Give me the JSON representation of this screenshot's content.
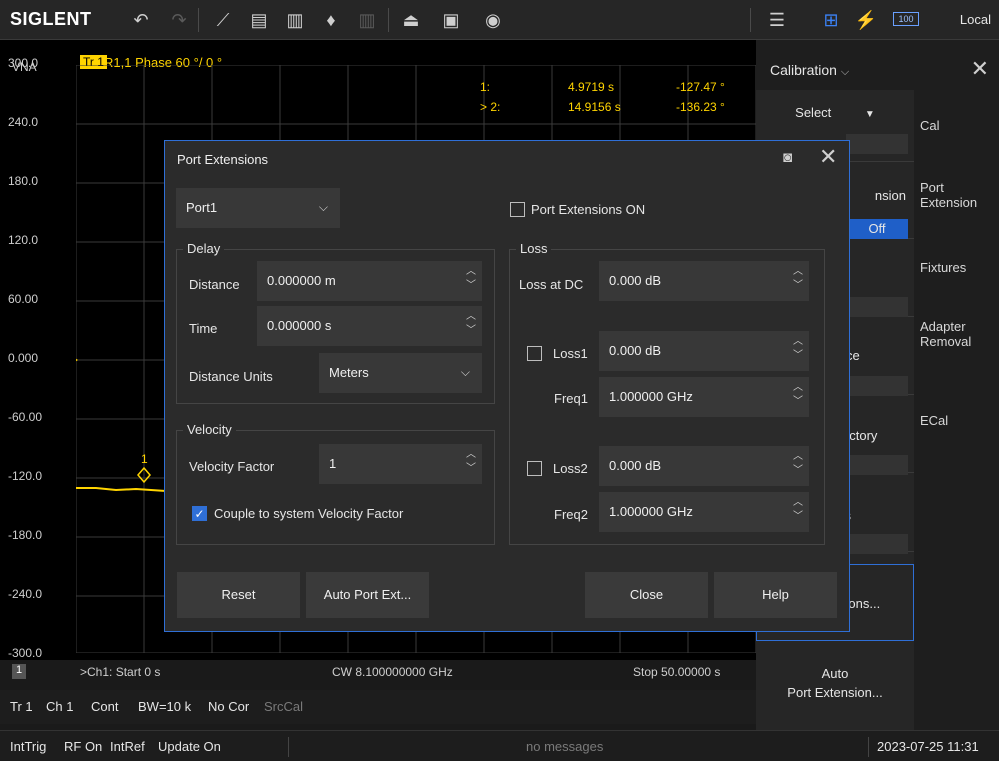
{
  "toolbar": {
    "logo": "SIGLENT",
    "icons": [
      "undo-icon",
      "redo-icon",
      "add-marker-icon",
      "add-trace-icon",
      "add-channel-icon",
      "add-marker-search-icon",
      "delete-icon",
      "open-file-icon",
      "save-icon",
      "screenshot-icon",
      "menu-icon",
      "usb-icon",
      "power-icon",
      "battery-icon"
    ],
    "battery": "100",
    "local": "Local"
  },
  "plot": {
    "vna": "VNA",
    "trace_badge": "Tr 1",
    "trace_info": "R1,1 Phase 60 °/ 0 °",
    "y_ticks": [
      "300.0",
      "240.0",
      "180.0",
      "120.0",
      "60.00",
      "0.000",
      "-60.00",
      "-120.0",
      "-180.0",
      "-240.0",
      "-300.0"
    ],
    "markers": [
      {
        "id": "1:",
        "x": "4.9719 s",
        "y": "-127.47 °"
      },
      {
        "id": "> 2:",
        "x": "14.9156 s",
        "y": "-136.23 °"
      }
    ],
    "marker_label": "1",
    "channel_num": "1",
    "start": ">Ch1: Start 0 s",
    "cw": "CW 8.100000000 GHz",
    "stop": "Stop 50.00000 s"
  },
  "status1": {
    "tr": "Tr 1",
    "ch": "Ch 1",
    "cont": "Cont",
    "bw": "BW=10 k",
    "cor": "No Cor",
    "src": "SrcCal"
  },
  "status2": {
    "trig": "IntTrig",
    "rf": "RF On",
    "ref": "IntRef",
    "update": "Update On",
    "msg": "no messages",
    "time": "2023-07-25 11:31"
  },
  "menu": {
    "title": "Calibration",
    "select": "Select",
    "ension": "nsion",
    "off": "Off",
    "ce": "ce",
    "actory": "actory",
    "ss": "ss",
    "sions": "sions...",
    "auto_line1": "Auto",
    "auto_line2": "Port Extension...",
    "tabs": [
      "Cal",
      "Port Extension",
      "Fixtures",
      "Adapter Removal",
      "ECal"
    ]
  },
  "dialog": {
    "title": "Port Extensions",
    "port": "Port1",
    "pe_on": "Port Extensions ON",
    "delay_label": "Delay",
    "distance_label": "Distance",
    "distance": "0.000000 m",
    "time_label": "Time",
    "time": "0.000000 s",
    "units_label": "Distance Units",
    "units": "Meters",
    "velocity_label": "Velocity",
    "vf_label": "Velocity Factor",
    "vf": "1",
    "couple": "Couple to system Velocity Factor",
    "loss_label": "Loss",
    "loss_dc_label": "Loss at DC",
    "loss_dc": "0.000 dB",
    "loss1_label": "Loss1",
    "loss1": "0.000 dB",
    "freq1_label": "Freq1",
    "freq1": "1.000000 GHz",
    "loss2_label": "Loss2",
    "loss2": "0.000 dB",
    "freq2_label": "Freq2",
    "freq2": "1.000000 GHz",
    "reset": "Reset",
    "auto": "Auto Port Ext...",
    "close": "Close",
    "help": "Help"
  }
}
